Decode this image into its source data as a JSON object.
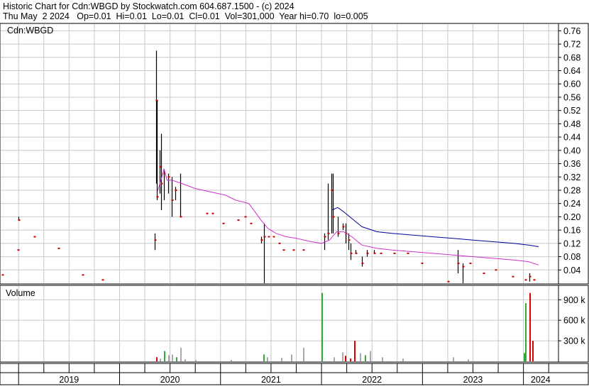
{
  "header": {
    "title": "Historic Chart for Cdn:WBGD by Stockwatch.com 604.687.1500 - (c) 2024",
    "quote": "Thu May  2 2024   Op=0.01  Hi=0.01  Lo=0.01  Cl=0.01  Vol=301,000  Year hi=0.70  lo=0.005"
  },
  "chart_data": [
    {
      "type": "line",
      "title": "Cdn:WBGD",
      "ylim": [
        0,
        0.78
      ],
      "y_ticks": [
        0.04,
        0.08,
        0.12,
        0.16,
        0.2,
        0.24,
        0.28,
        0.32,
        0.36,
        0.4,
        0.44,
        0.48,
        0.52,
        0.56,
        0.6,
        0.64,
        0.68,
        0.72,
        0.76
      ],
      "y_tick_labels": [
        "0.04",
        "0.08",
        "0.12",
        "0.16",
        "0.20",
        "0.24",
        "0.28",
        "0.32",
        "0.36",
        "0.40",
        "0.44",
        "0.48",
        "0.52",
        "0.56",
        "0.60",
        "0.64",
        "0.68",
        "0.72",
        "0.76"
      ],
      "x_range": [
        2018.83,
        2024.34
      ],
      "x_labels": [
        "2019",
        "2020",
        "2021",
        "2022",
        "2023",
        "2024"
      ],
      "grid": true,
      "colors": {
        "up": "#000000",
        "close": "#cc0000",
        "ma_short": "#cc33cc",
        "ma_long": "#000099"
      },
      "price_bars": [
        {
          "x": 2018.84,
          "low": 0.025,
          "high": 0.025,
          "close": 0.025
        },
        {
          "x": 2019.0,
          "low": 0.19,
          "high": 0.2,
          "close": 0.19
        },
        {
          "x": 2018.99,
          "low": 0.1,
          "high": 0.1,
          "close": 0.1
        },
        {
          "x": 2019.15,
          "low": 0.14,
          "high": 0.14,
          "close": 0.14
        },
        {
          "x": 2019.39,
          "low": 0.105,
          "high": 0.105,
          "close": 0.105
        },
        {
          "x": 2019.63,
          "low": 0.025,
          "high": 0.025,
          "close": 0.025
        },
        {
          "x": 2019.83,
          "low": 0.01,
          "high": 0.01,
          "close": 0.01
        },
        {
          "x": 2020.35,
          "low": 0.1,
          "high": 0.15,
          "close": 0.13
        },
        {
          "x": 2020.36,
          "low": 0.3,
          "high": 0.7,
          "close": 0.55
        },
        {
          "x": 2020.37,
          "low": 0.25,
          "high": 0.55,
          "close": 0.26
        },
        {
          "x": 2020.4,
          "low": 0.27,
          "high": 0.4,
          "close": 0.35
        },
        {
          "x": 2020.41,
          "low": 0.22,
          "high": 0.45,
          "close": 0.3
        },
        {
          "x": 2020.44,
          "low": 0.25,
          "high": 0.34,
          "close": 0.33
        },
        {
          "x": 2020.48,
          "low": 0.27,
          "high": 0.33,
          "close": 0.32
        },
        {
          "x": 2020.52,
          "low": 0.2,
          "high": 0.32,
          "close": 0.25
        },
        {
          "x": 2020.55,
          "low": 0.25,
          "high": 0.29,
          "close": 0.28
        },
        {
          "x": 2020.6,
          "low": 0.2,
          "high": 0.33,
          "close": 0.2
        },
        {
          "x": 2020.86,
          "low": 0.21,
          "high": 0.21,
          "close": 0.21
        },
        {
          "x": 2020.92,
          "low": 0.21,
          "high": 0.21,
          "close": 0.21
        },
        {
          "x": 2021.02,
          "low": 0.18,
          "high": 0.18,
          "close": 0.18
        },
        {
          "x": 2021.17,
          "low": 0.19,
          "high": 0.19,
          "close": 0.19
        },
        {
          "x": 2021.24,
          "low": 0.2,
          "high": 0.2,
          "close": 0.2
        },
        {
          "x": 2021.3,
          "low": 0.18,
          "high": 0.18,
          "close": 0.18
        },
        {
          "x": 2021.4,
          "low": 0.12,
          "high": 0.14,
          "close": 0.13
        },
        {
          "x": 2021.43,
          "low": 0.0,
          "high": 0.18,
          "close": 0.14
        },
        {
          "x": 2021.47,
          "low": 0.14,
          "high": 0.14,
          "close": 0.14
        },
        {
          "x": 2021.52,
          "low": 0.14,
          "high": 0.14,
          "close": 0.14
        },
        {
          "x": 2021.58,
          "low": 0.12,
          "high": 0.12,
          "close": 0.12
        },
        {
          "x": 2021.62,
          "low": 0.1,
          "high": 0.1,
          "close": 0.1
        },
        {
          "x": 2021.72,
          "low": 0.1,
          "high": 0.1,
          "close": 0.1
        },
        {
          "x": 2021.82,
          "low": 0.1,
          "high": 0.1,
          "close": 0.1
        },
        {
          "x": 2022.03,
          "low": 0.1,
          "high": 0.15,
          "close": 0.14
        },
        {
          "x": 2022.06,
          "low": 0.13,
          "high": 0.3,
          "close": 0.15
        },
        {
          "x": 2022.1,
          "low": 0.15,
          "high": 0.33,
          "close": 0.28
        },
        {
          "x": 2022.11,
          "low": 0.15,
          "high": 0.33,
          "close": 0.2
        },
        {
          "x": 2022.16,
          "low": 0.14,
          "high": 0.2,
          "close": 0.15
        },
        {
          "x": 2022.21,
          "low": 0.16,
          "high": 0.18,
          "close": 0.17
        },
        {
          "x": 2022.24,
          "low": 0.12,
          "high": 0.18,
          "close": 0.15
        },
        {
          "x": 2022.27,
          "low": 0.1,
          "high": 0.15,
          "close": 0.13
        },
        {
          "x": 2022.29,
          "low": 0.07,
          "high": 0.12,
          "close": 0.09
        },
        {
          "x": 2022.34,
          "low": 0.09,
          "high": 0.1,
          "close": 0.09
        },
        {
          "x": 2022.4,
          "low": 0.05,
          "high": 0.08,
          "close": 0.06
        },
        {
          "x": 2022.45,
          "low": 0.08,
          "high": 0.1,
          "close": 0.09
        },
        {
          "x": 2022.52,
          "low": 0.09,
          "high": 0.1,
          "close": 0.09
        },
        {
          "x": 2022.58,
          "low": 0.09,
          "high": 0.09,
          "close": 0.09
        },
        {
          "x": 2022.72,
          "low": 0.09,
          "high": 0.09,
          "close": 0.09
        },
        {
          "x": 2022.85,
          "low": 0.09,
          "high": 0.09,
          "close": 0.09
        },
        {
          "x": 2022.99,
          "low": 0.06,
          "high": 0.06,
          "close": 0.06
        },
        {
          "x": 2023.25,
          "low": 0.005,
          "high": 0.005,
          "close": 0.005
        },
        {
          "x": 2023.35,
          "low": 0.03,
          "high": 0.1,
          "close": 0.06
        },
        {
          "x": 2023.4,
          "low": 0.0,
          "high": 0.06,
          "close": 0.05
        },
        {
          "x": 2023.47,
          "low": 0.06,
          "high": 0.06,
          "close": 0.06
        },
        {
          "x": 2023.6,
          "low": 0.03,
          "high": 0.03,
          "close": 0.03
        },
        {
          "x": 2023.72,
          "low": 0.04,
          "high": 0.04,
          "close": 0.04
        },
        {
          "x": 2023.89,
          "low": 0.02,
          "high": 0.02,
          "close": 0.02
        },
        {
          "x": 2024.02,
          "low": 0.01,
          "high": 0.01,
          "close": 0.01
        },
        {
          "x": 2024.06,
          "low": 0.005,
          "high": 0.03,
          "close": 0.02
        },
        {
          "x": 2024.1,
          "low": 0.01,
          "high": 0.01,
          "close": 0.01
        }
      ],
      "ma_short": [
        [
          2020.38,
          0.28
        ],
        [
          2020.42,
          0.32
        ],
        [
          2020.44,
          0.345
        ],
        [
          2020.47,
          0.31
        ],
        [
          2020.52,
          0.31
        ],
        [
          2020.62,
          0.3
        ],
        [
          2020.75,
          0.285
        ],
        [
          2020.9,
          0.275
        ],
        [
          2021.05,
          0.265
        ],
        [
          2021.15,
          0.25
        ],
        [
          2021.22,
          0.245
        ],
        [
          2021.28,
          0.24
        ],
        [
          2021.33,
          0.22
        ],
        [
          2021.4,
          0.19
        ],
        [
          2021.47,
          0.165
        ],
        [
          2021.55,
          0.15
        ],
        [
          2021.65,
          0.14
        ],
        [
          2021.75,
          0.135
        ],
        [
          2021.9,
          0.125
        ],
        [
          2022.0,
          0.12
        ],
        [
          2022.08,
          0.13
        ],
        [
          2022.15,
          0.155
        ],
        [
          2022.22,
          0.155
        ],
        [
          2022.3,
          0.14
        ],
        [
          2022.4,
          0.115
        ],
        [
          2022.55,
          0.105
        ],
        [
          2022.7,
          0.1
        ],
        [
          2022.9,
          0.095
        ],
        [
          2023.1,
          0.09
        ],
        [
          2023.3,
          0.085
        ],
        [
          2023.5,
          0.08
        ],
        [
          2023.7,
          0.075
        ],
        [
          2023.9,
          0.07
        ],
        [
          2024.05,
          0.065
        ],
        [
          2024.15,
          0.055
        ]
      ],
      "ma_long": [
        [
          2022.1,
          0.22
        ],
        [
          2022.16,
          0.228
        ],
        [
          2022.22,
          0.215
        ],
        [
          2022.3,
          0.195
        ],
        [
          2022.4,
          0.17
        ],
        [
          2022.55,
          0.155
        ],
        [
          2022.7,
          0.15
        ],
        [
          2022.9,
          0.145
        ],
        [
          2023.1,
          0.14
        ],
        [
          2023.3,
          0.135
        ],
        [
          2023.5,
          0.13
        ],
        [
          2023.7,
          0.125
        ],
        [
          2023.9,
          0.12
        ],
        [
          2024.05,
          0.115
        ],
        [
          2024.15,
          0.11
        ]
      ]
    },
    {
      "type": "bar",
      "title": "Volume",
      "ylim": [
        0,
        1100000
      ],
      "y_ticks": [
        300000,
        600000,
        900000
      ],
      "y_tick_labels": [
        "300 k",
        "600 k",
        "900 k"
      ],
      "bars": [
        {
          "x": 2020.36,
          "v": 60000,
          "c": "red"
        },
        {
          "x": 2020.4,
          "v": 40000,
          "c": "grey"
        },
        {
          "x": 2020.44,
          "v": 150000,
          "c": "green"
        },
        {
          "x": 2020.48,
          "v": 90000,
          "c": "grey"
        },
        {
          "x": 2020.52,
          "v": 100000,
          "c": "grey"
        },
        {
          "x": 2020.56,
          "v": 60000,
          "c": "green"
        },
        {
          "x": 2020.6,
          "v": 200000,
          "c": "grey"
        },
        {
          "x": 2020.64,
          "v": 30000,
          "c": "grey"
        },
        {
          "x": 2020.75,
          "v": 20000,
          "c": "grey"
        },
        {
          "x": 2021.1,
          "v": 20000,
          "c": "grey"
        },
        {
          "x": 2021.42,
          "v": 100000,
          "c": "green"
        },
        {
          "x": 2021.46,
          "v": 60000,
          "c": "grey"
        },
        {
          "x": 2021.6,
          "v": 50000,
          "c": "grey"
        },
        {
          "x": 2021.7,
          "v": 100000,
          "c": "grey"
        },
        {
          "x": 2021.82,
          "v": 200000,
          "c": "grey"
        },
        {
          "x": 2022.0,
          "v": 1000000,
          "c": "green"
        },
        {
          "x": 2022.12,
          "v": 60000,
          "c": "grey"
        },
        {
          "x": 2022.2,
          "v": 130000,
          "c": "grey"
        },
        {
          "x": 2022.23,
          "v": 80000,
          "c": "red"
        },
        {
          "x": 2022.28,
          "v": 40000,
          "c": "red"
        },
        {
          "x": 2022.32,
          "v": 300000,
          "c": "red"
        },
        {
          "x": 2022.38,
          "v": 120000,
          "c": "grey"
        },
        {
          "x": 2022.43,
          "v": 90000,
          "c": "green"
        },
        {
          "x": 2022.48,
          "v": 150000,
          "c": "grey"
        },
        {
          "x": 2022.6,
          "v": 60000,
          "c": "grey"
        },
        {
          "x": 2022.8,
          "v": 40000,
          "c": "grey"
        },
        {
          "x": 2023.3,
          "v": 60000,
          "c": "grey"
        },
        {
          "x": 2023.45,
          "v": 30000,
          "c": "grey"
        },
        {
          "x": 2024.0,
          "v": 120000,
          "c": "green"
        },
        {
          "x": 2024.02,
          "v": 850000,
          "c": "green"
        },
        {
          "x": 2024.06,
          "v": 1000000,
          "c": "red"
        },
        {
          "x": 2024.09,
          "v": 300000,
          "c": "red"
        }
      ]
    }
  ]
}
